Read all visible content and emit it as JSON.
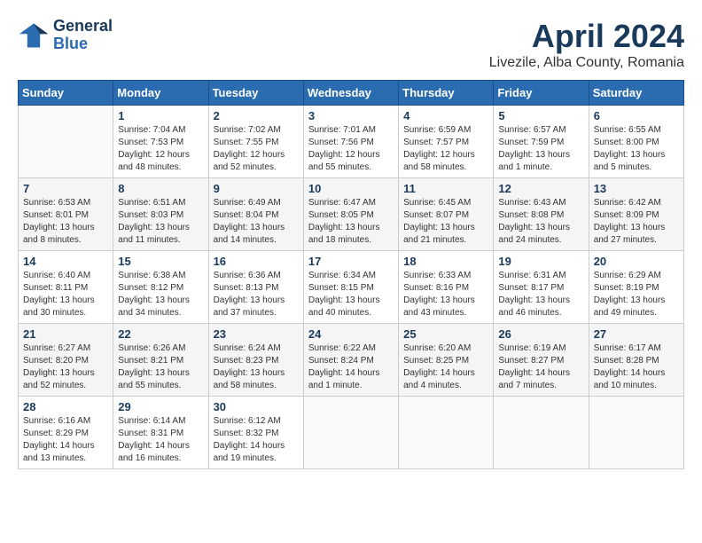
{
  "header": {
    "logo_text_top": "General",
    "logo_text_bottom": "Blue",
    "month_title": "April 2024",
    "location": "Livezile, Alba County, Romania"
  },
  "weekdays": [
    "Sunday",
    "Monday",
    "Tuesday",
    "Wednesday",
    "Thursday",
    "Friday",
    "Saturday"
  ],
  "weeks": [
    [
      {
        "day": "",
        "info": ""
      },
      {
        "day": "1",
        "info": "Sunrise: 7:04 AM\nSunset: 7:53 PM\nDaylight: 12 hours\nand 48 minutes."
      },
      {
        "day": "2",
        "info": "Sunrise: 7:02 AM\nSunset: 7:55 PM\nDaylight: 12 hours\nand 52 minutes."
      },
      {
        "day": "3",
        "info": "Sunrise: 7:01 AM\nSunset: 7:56 PM\nDaylight: 12 hours\nand 55 minutes."
      },
      {
        "day": "4",
        "info": "Sunrise: 6:59 AM\nSunset: 7:57 PM\nDaylight: 12 hours\nand 58 minutes."
      },
      {
        "day": "5",
        "info": "Sunrise: 6:57 AM\nSunset: 7:59 PM\nDaylight: 13 hours\nand 1 minute."
      },
      {
        "day": "6",
        "info": "Sunrise: 6:55 AM\nSunset: 8:00 PM\nDaylight: 13 hours\nand 5 minutes."
      }
    ],
    [
      {
        "day": "7",
        "info": "Sunrise: 6:53 AM\nSunset: 8:01 PM\nDaylight: 13 hours\nand 8 minutes."
      },
      {
        "day": "8",
        "info": "Sunrise: 6:51 AM\nSunset: 8:03 PM\nDaylight: 13 hours\nand 11 minutes."
      },
      {
        "day": "9",
        "info": "Sunrise: 6:49 AM\nSunset: 8:04 PM\nDaylight: 13 hours\nand 14 minutes."
      },
      {
        "day": "10",
        "info": "Sunrise: 6:47 AM\nSunset: 8:05 PM\nDaylight: 13 hours\nand 18 minutes."
      },
      {
        "day": "11",
        "info": "Sunrise: 6:45 AM\nSunset: 8:07 PM\nDaylight: 13 hours\nand 21 minutes."
      },
      {
        "day": "12",
        "info": "Sunrise: 6:43 AM\nSunset: 8:08 PM\nDaylight: 13 hours\nand 24 minutes."
      },
      {
        "day": "13",
        "info": "Sunrise: 6:42 AM\nSunset: 8:09 PM\nDaylight: 13 hours\nand 27 minutes."
      }
    ],
    [
      {
        "day": "14",
        "info": "Sunrise: 6:40 AM\nSunset: 8:11 PM\nDaylight: 13 hours\nand 30 minutes."
      },
      {
        "day": "15",
        "info": "Sunrise: 6:38 AM\nSunset: 8:12 PM\nDaylight: 13 hours\nand 34 minutes."
      },
      {
        "day": "16",
        "info": "Sunrise: 6:36 AM\nSunset: 8:13 PM\nDaylight: 13 hours\nand 37 minutes."
      },
      {
        "day": "17",
        "info": "Sunrise: 6:34 AM\nSunset: 8:15 PM\nDaylight: 13 hours\nand 40 minutes."
      },
      {
        "day": "18",
        "info": "Sunrise: 6:33 AM\nSunset: 8:16 PM\nDaylight: 13 hours\nand 43 minutes."
      },
      {
        "day": "19",
        "info": "Sunrise: 6:31 AM\nSunset: 8:17 PM\nDaylight: 13 hours\nand 46 minutes."
      },
      {
        "day": "20",
        "info": "Sunrise: 6:29 AM\nSunset: 8:19 PM\nDaylight: 13 hours\nand 49 minutes."
      }
    ],
    [
      {
        "day": "21",
        "info": "Sunrise: 6:27 AM\nSunset: 8:20 PM\nDaylight: 13 hours\nand 52 minutes."
      },
      {
        "day": "22",
        "info": "Sunrise: 6:26 AM\nSunset: 8:21 PM\nDaylight: 13 hours\nand 55 minutes."
      },
      {
        "day": "23",
        "info": "Sunrise: 6:24 AM\nSunset: 8:23 PM\nDaylight: 13 hours\nand 58 minutes."
      },
      {
        "day": "24",
        "info": "Sunrise: 6:22 AM\nSunset: 8:24 PM\nDaylight: 14 hours\nand 1 minute."
      },
      {
        "day": "25",
        "info": "Sunrise: 6:20 AM\nSunset: 8:25 PM\nDaylight: 14 hours\nand 4 minutes."
      },
      {
        "day": "26",
        "info": "Sunrise: 6:19 AM\nSunset: 8:27 PM\nDaylight: 14 hours\nand 7 minutes."
      },
      {
        "day": "27",
        "info": "Sunrise: 6:17 AM\nSunset: 8:28 PM\nDaylight: 14 hours\nand 10 minutes."
      }
    ],
    [
      {
        "day": "28",
        "info": "Sunrise: 6:16 AM\nSunset: 8:29 PM\nDaylight: 14 hours\nand 13 minutes."
      },
      {
        "day": "29",
        "info": "Sunrise: 6:14 AM\nSunset: 8:31 PM\nDaylight: 14 hours\nand 16 minutes."
      },
      {
        "day": "30",
        "info": "Sunrise: 6:12 AM\nSunset: 8:32 PM\nDaylight: 14 hours\nand 19 minutes."
      },
      {
        "day": "",
        "info": ""
      },
      {
        "day": "",
        "info": ""
      },
      {
        "day": "",
        "info": ""
      },
      {
        "day": "",
        "info": ""
      }
    ]
  ]
}
